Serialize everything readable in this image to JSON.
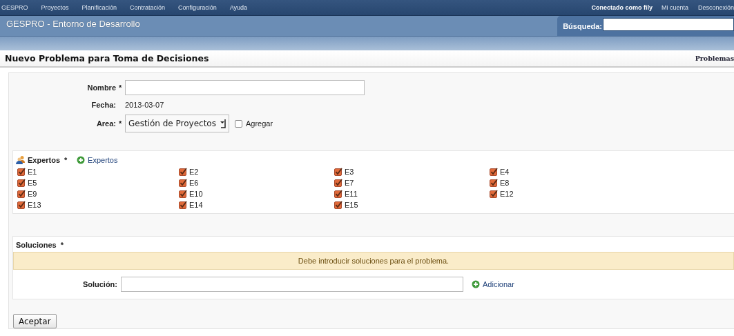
{
  "menu": {
    "items": [
      "GESPRO",
      "Proyectos",
      "Planificación",
      "Contratación",
      "Configuración",
      "Ayuda"
    ],
    "user_prefix": "Conectado como",
    "user": "fily",
    "links": [
      "Mi cuenta",
      "Desconexión"
    ]
  },
  "header": {
    "title": "GESPRO - Entorno de Desarrollo",
    "search_label": "Búsqueda:"
  },
  "page": {
    "title": "Nuevo Problema para Toma de Decisiones",
    "link": "Problemas"
  },
  "form": {
    "fields": [
      {
        "kind": "text",
        "label": "Nombre",
        "mark": "*"
      },
      {
        "kind": "static",
        "label": "Fecha:",
        "value": "2013-03-07"
      },
      {
        "kind": "select",
        "label": "Area:",
        "mark": "*",
        "value": "Gestión de Proyectos",
        "option": {
          "label": "Agregar",
          "checked": false
        }
      }
    ]
  },
  "experts": {
    "title": "Expertos",
    "mark": "*",
    "add_link": "Expertos",
    "items": [
      {
        "label": "E1",
        "checked": true
      },
      {
        "label": "E2",
        "checked": true
      },
      {
        "label": "E3",
        "checked": true
      },
      {
        "label": "E4",
        "checked": true
      },
      {
        "label": "E5",
        "checked": true
      },
      {
        "label": "E6",
        "checked": true
      },
      {
        "label": "E7",
        "checked": true
      },
      {
        "label": "E8",
        "checked": true
      },
      {
        "label": "E9",
        "checked": true
      },
      {
        "label": "E10",
        "checked": true
      },
      {
        "label": "E11",
        "checked": true
      },
      {
        "label": "E12",
        "checked": true
      },
      {
        "label": "E13",
        "checked": true
      },
      {
        "label": "E14",
        "checked": true
      },
      {
        "label": "E15",
        "checked": true
      }
    ]
  },
  "solutions": {
    "title": "Soluciones",
    "mark": "*",
    "warning": "Debe introducir soluciones para el problema.",
    "field_label": "Solución:",
    "add_link": "Adicionar"
  },
  "submit": "Aceptar"
}
